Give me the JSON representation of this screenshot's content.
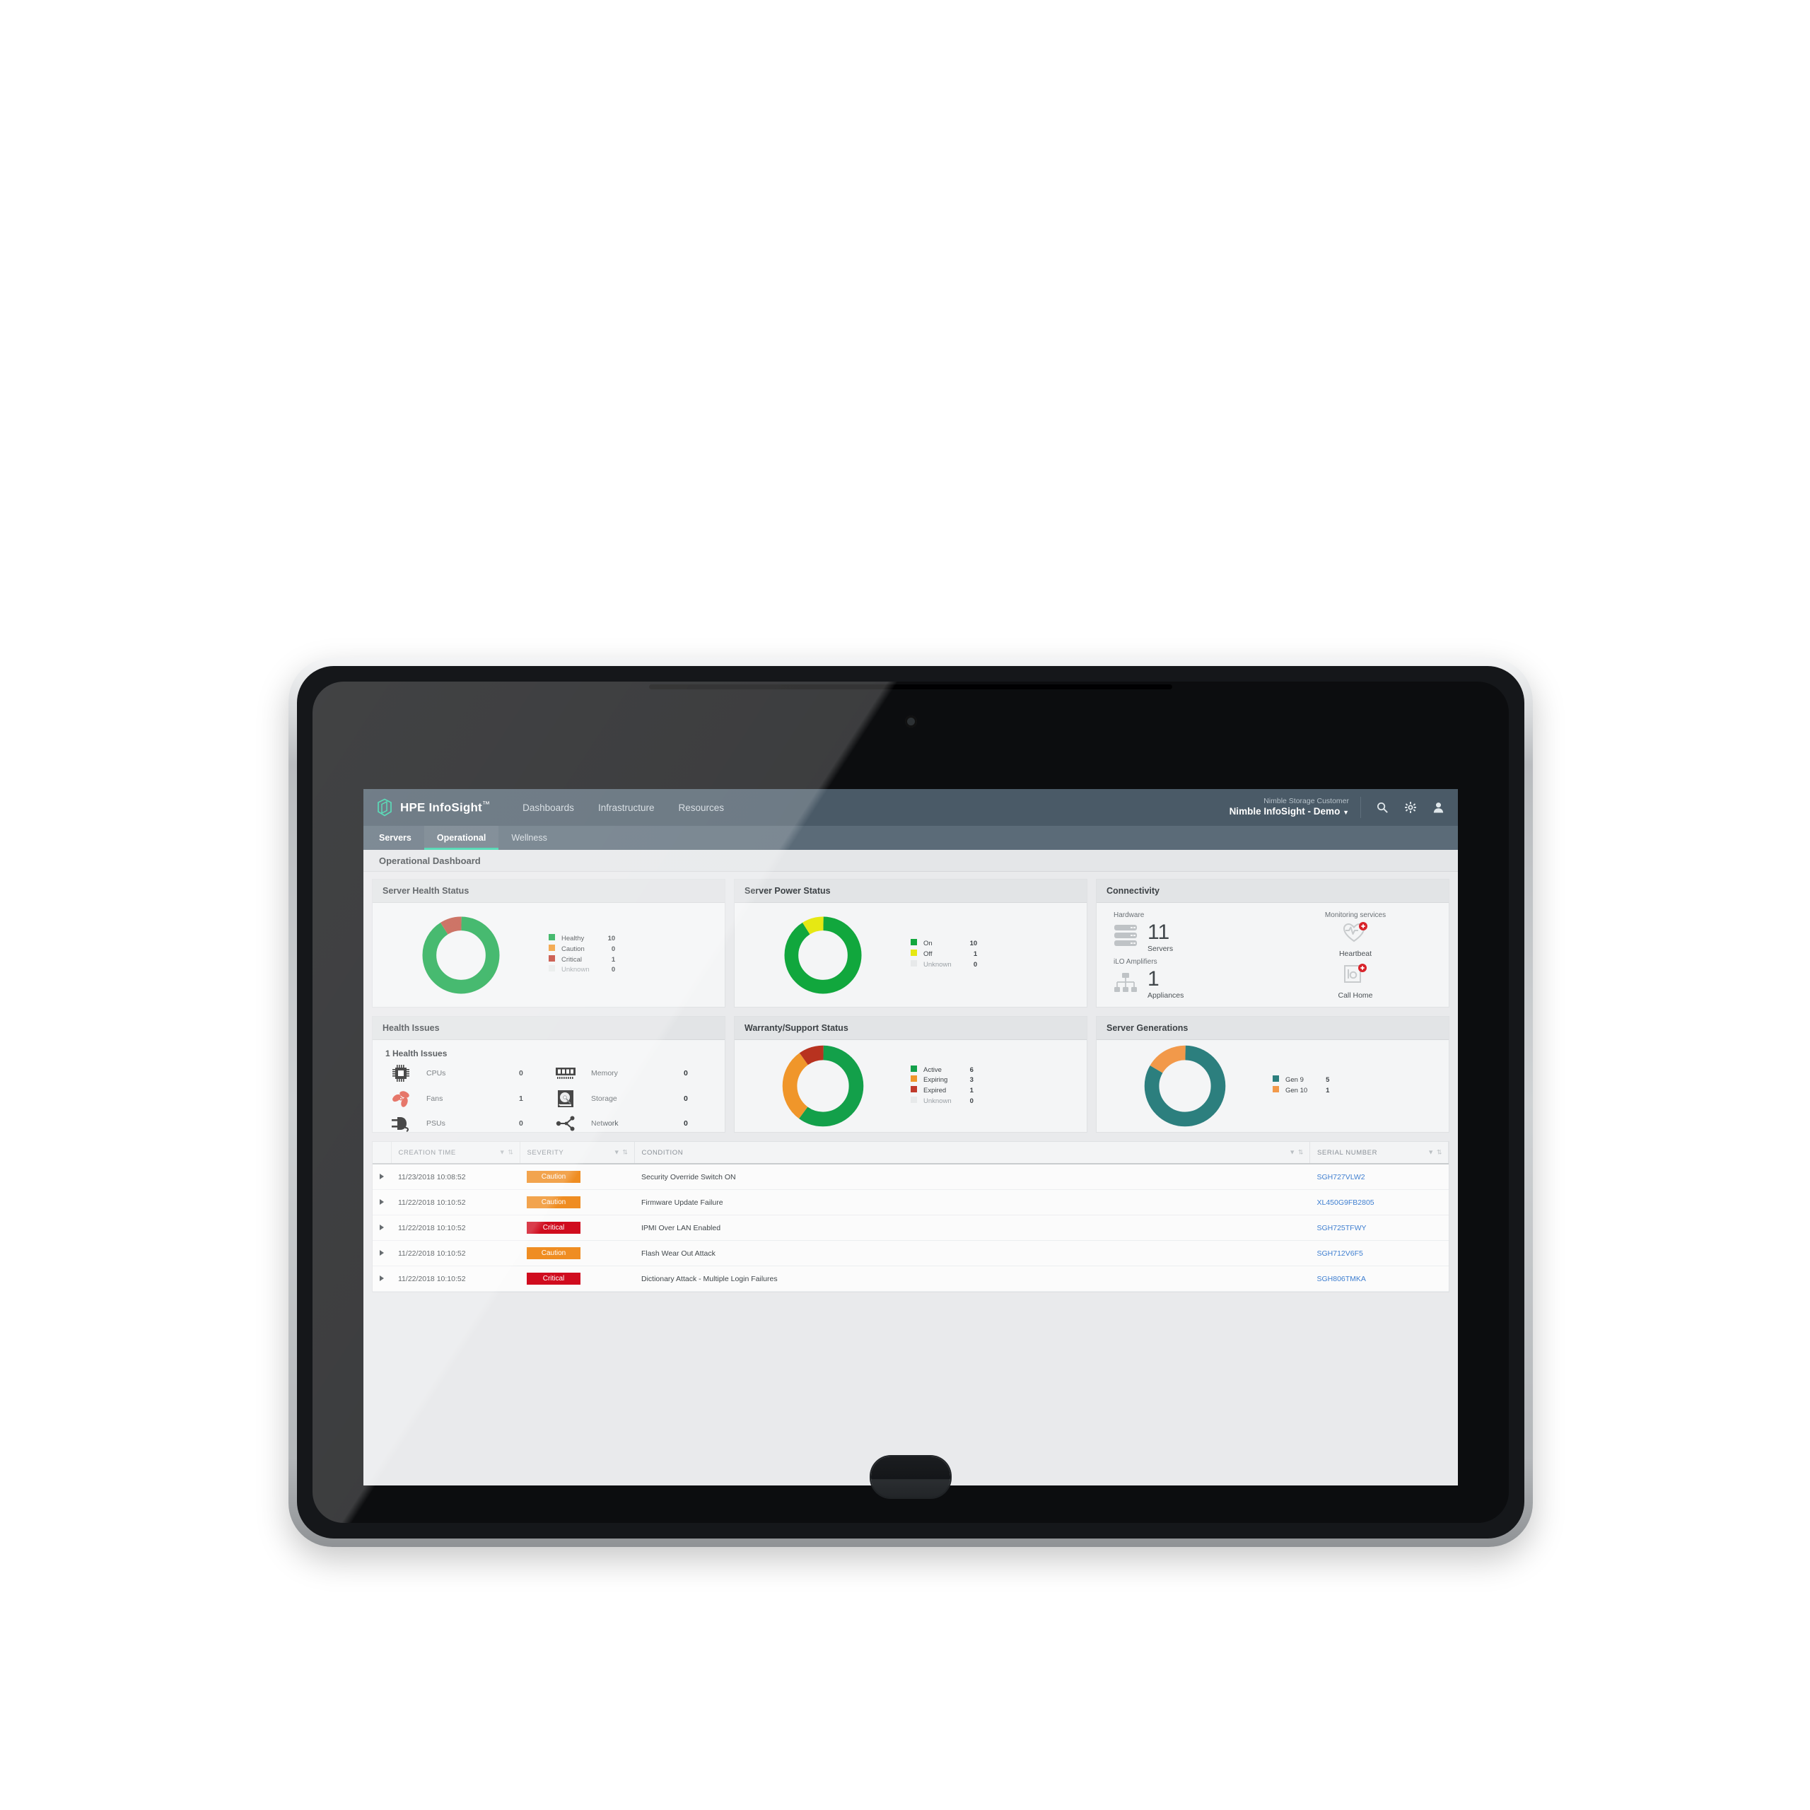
{
  "app": {
    "brand": "HPE InfoSight",
    "brand_tm": "™",
    "nav": [
      {
        "label": "Dashboards"
      },
      {
        "label": "Infrastructure"
      },
      {
        "label": "Resources"
      }
    ],
    "tenant_small": "Nimble Storage Customer",
    "tenant_big": "Nimble InfoSight - Demo",
    "tenant_caret": "▼",
    "icons": {
      "search": "search-icon",
      "gear": "gear-icon",
      "user": "user-icon"
    },
    "tabs": [
      {
        "label": "Servers",
        "active": false,
        "first": true
      },
      {
        "label": "Operational",
        "active": true
      },
      {
        "label": "Wellness",
        "active": false
      }
    ],
    "page_title": "Operational Dashboard"
  },
  "colors": {
    "healthy_green": "#17a84a",
    "caution_orange": "#ef8d22",
    "critical_red": "#c0392b",
    "unknown_grey": "#e3e5e6",
    "power_on_green": "#11a73d",
    "power_off_yellow": "#e6e813",
    "gen9_teal": "#2c7f7e",
    "gen10_orange": "#f2994a",
    "accent_teal": "#2fd0a5",
    "link_blue": "#3f7fd0",
    "header_bg": "#4a5a67",
    "tab_bg": "#5b6b78"
  },
  "cards": {
    "server_health": {
      "title": "Server Health Status"
    },
    "server_power": {
      "title": "Server Power Status"
    },
    "connectivity": {
      "title": "Connectivity"
    },
    "health_issues": {
      "title": "Health Issues"
    },
    "warranty": {
      "title": "Warranty/Support Status"
    },
    "generations": {
      "title": "Server Generations"
    }
  },
  "connectivity": {
    "hardware_label": "Hardware",
    "servers_count": "11",
    "servers_label": "Servers",
    "ilo_label": "iLO Amplifiers",
    "appliances_count": "1",
    "appliances_label": "Appliances",
    "monitoring_label": "Monitoring services",
    "heartbeat_label": "Heartbeat",
    "callhome_label": "Call Home"
  },
  "health_issues": {
    "summary": "1 Health Issues",
    "items": [
      {
        "icon": "cpu-icon",
        "label": "CPUs",
        "value": "0"
      },
      {
        "icon": "memory-icon",
        "label": "Memory",
        "value": "0"
      },
      {
        "icon": "fan-icon",
        "label": "Fans",
        "value": "1"
      },
      {
        "icon": "storage-icon",
        "label": "Storage",
        "value": "0"
      },
      {
        "icon": "psu-icon",
        "label": "PSUs",
        "value": "0"
      },
      {
        "icon": "network-icon",
        "label": "Network",
        "value": "0"
      }
    ]
  },
  "chart_data": [
    {
      "type": "pie",
      "title": "Server Health Status",
      "categories": [
        "Healthy",
        "Caution",
        "Critical",
        "Unknown"
      ],
      "values": [
        10,
        0,
        1,
        0
      ],
      "colors": [
        "#17a84a",
        "#f0962a",
        "#c0392b",
        "#e7e9ea"
      ],
      "legend": "right"
    },
    {
      "type": "pie",
      "title": "Server Power Status",
      "categories": [
        "On",
        "Off",
        "Unknown"
      ],
      "values": [
        10,
        1,
        0
      ],
      "colors": [
        "#11a73d",
        "#e6e813",
        "#e7e9ea"
      ],
      "legend": "right"
    },
    {
      "type": "pie",
      "title": "Warranty/Support Status",
      "categories": [
        "Active",
        "Expiring",
        "Expired",
        "Unknown"
      ],
      "values": [
        6,
        3,
        1,
        0
      ],
      "colors": [
        "#13a04a",
        "#f0962a",
        "#c0392b",
        "#e7e9ea"
      ],
      "legend": "right"
    },
    {
      "type": "pie",
      "title": "Server Generations",
      "categories": [
        "Gen 9",
        "Gen 10"
      ],
      "values": [
        5,
        1
      ],
      "colors": [
        "#2c7f7e",
        "#f2994a"
      ],
      "legend": "right"
    }
  ],
  "table": {
    "columns": [
      {
        "key": "expand",
        "label": ""
      },
      {
        "key": "creation_time",
        "label": "CREATION TIME"
      },
      {
        "key": "severity",
        "label": "SEVERITY"
      },
      {
        "key": "condition",
        "label": "CONDITION"
      },
      {
        "key": "serial",
        "label": "SERIAL NUMBER"
      }
    ],
    "rows": [
      {
        "time": "11/23/2018 10:08:52",
        "severity": "Caution",
        "sev_type": "caution",
        "condition": "Security Override Switch ON",
        "serial": "SGH727VLW2"
      },
      {
        "time": "11/22/2018 10:10:52",
        "severity": "Caution",
        "sev_type": "caution",
        "condition": "Firmware Update Failure",
        "serial": "XL450G9FB2805"
      },
      {
        "time": "11/22/2018 10:10:52",
        "severity": "Critical",
        "sev_type": "critical",
        "condition": "IPMI Over LAN Enabled",
        "serial": "SGH725TFWY"
      },
      {
        "time": "11/22/2018 10:10:52",
        "severity": "Caution",
        "sev_type": "caution",
        "condition": "Flash Wear Out Attack",
        "serial": "SGH712V6F5"
      },
      {
        "time": "11/22/2018 10:10:52",
        "severity": "Critical",
        "sev_type": "critical",
        "condition": "Dictionary Attack - Multiple Login Failures",
        "serial": "SGH806TMKA"
      }
    ]
  }
}
